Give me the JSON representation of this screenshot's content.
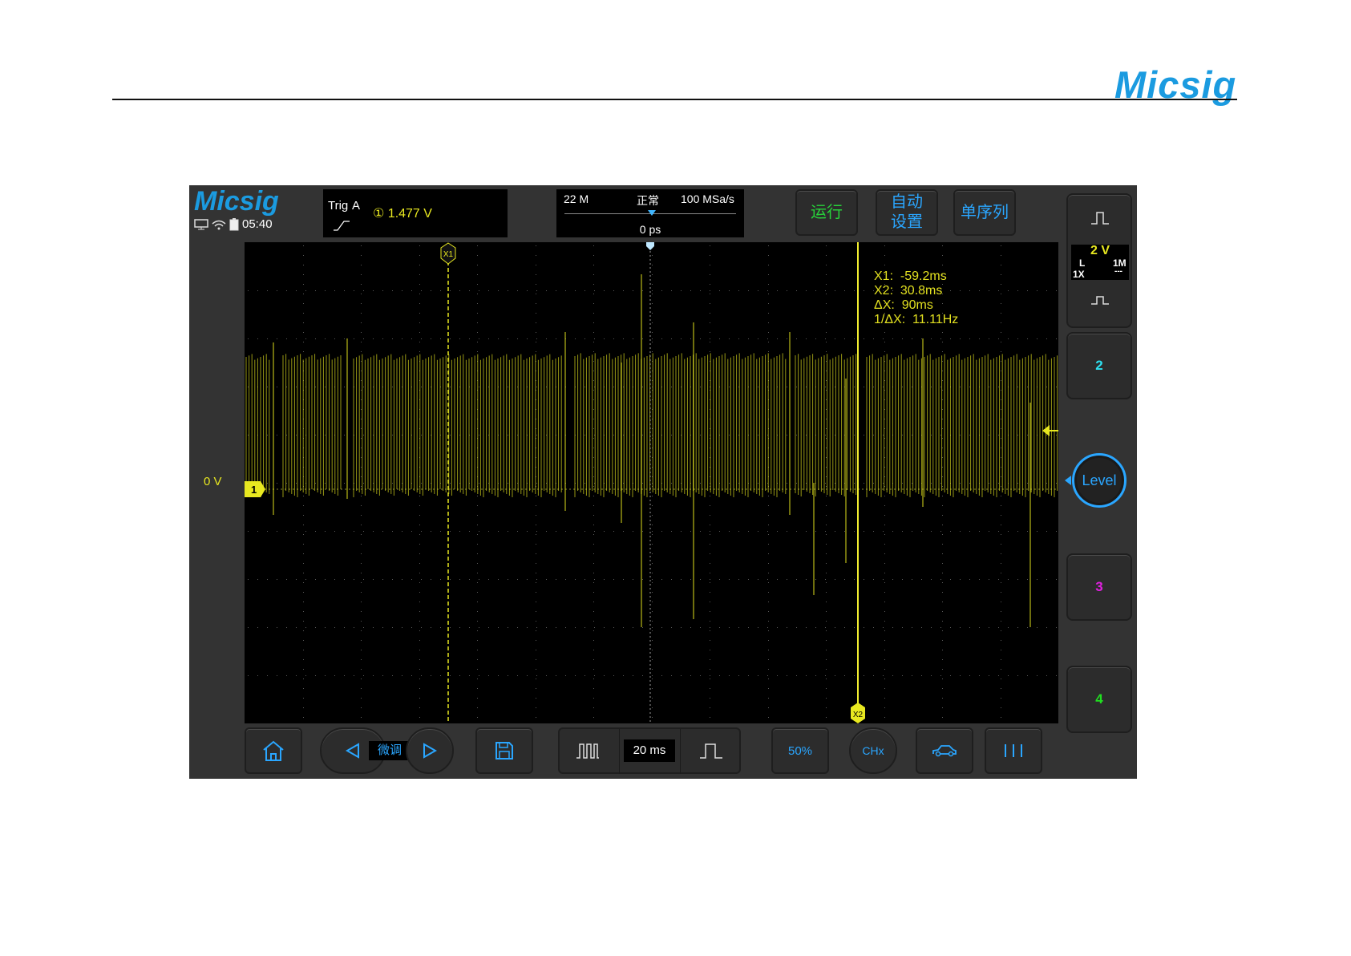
{
  "brand": "Micsig",
  "scope": {
    "logo": "Micsig",
    "clock": "05:40",
    "trigger": {
      "title": "Trig",
      "source": "A",
      "level": "① 1.477  V"
    },
    "timebase": {
      "memory": "22 M",
      "mode": "正常",
      "sample_rate": "100 MSa/s",
      "delay": "0 ps"
    },
    "buttons": {
      "run": "运行",
      "auto_line1": "自动",
      "auto_line2": "设置",
      "single": "单序列"
    },
    "readout": {
      "x1": "X1:  -59.2ms",
      "x2": "X2:  30.8ms",
      "dx": "ΔX:  90ms",
      "inv_dx": "1/ΔX:  11.11Hz"
    },
    "cursor_labels": {
      "x1": "X1",
      "x2": "X2"
    },
    "zero_label": "0  V",
    "ch1_marker": "1",
    "channels": {
      "ch1_volts": "2 V",
      "ch1_coupling": "L",
      "ch1_impedance": "1M",
      "ch1_probe": "1X",
      "ch1_dc": "---",
      "ch2": "2",
      "ch3": "3",
      "ch4": "4"
    },
    "level_button": "Level",
    "bottom": {
      "fine": "微调",
      "time_div": "20 ms",
      "fifty": "50%",
      "chx": "CHx"
    },
    "colors": {
      "ch1": "#e8e820",
      "ch2": "#2de0f0",
      "ch3": "#e020e0",
      "ch4": "#20e020",
      "accent": "#2aa6ff"
    }
  }
}
